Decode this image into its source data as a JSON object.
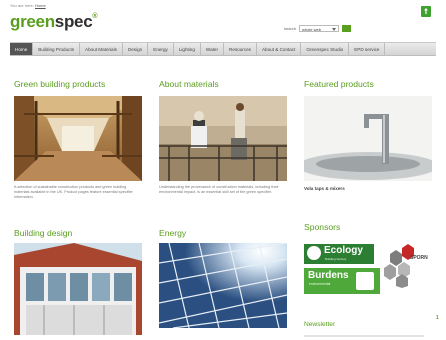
{
  "breadcrumb": {
    "prefix": "You are here:",
    "current": "Home"
  },
  "logo": {
    "green": "green",
    "dark": "spec",
    "mark": "®"
  },
  "search": {
    "label": "search",
    "scope": "whole web"
  },
  "nav": [
    "Home",
    "Building Products",
    "About Materials",
    "Design",
    "Energy",
    "Lighting",
    "Water",
    "Resources",
    "About & Contact",
    "Greenspec Studio",
    "EPD service"
  ],
  "sections": {
    "green_products": {
      "title": "Green building products",
      "caption": "A selection of sustainable construction products and green building materials available in the UK. Product pages feature essential specifier information."
    },
    "about_materials": {
      "title": "About materials",
      "caption": "Understanding the provenance of construction materials, including their environmental impact, is an essential skill set of the green specifier."
    },
    "featured": {
      "title": "Featured products",
      "caption": "Vola taps & mixers"
    },
    "building_design": {
      "title": "Building design"
    },
    "energy": {
      "title": "Energy"
    },
    "sponsors": {
      "title": "Sponsors",
      "ecology": "Ecology",
      "ecology_sub": "Building Society",
      "burdens": "Burdens",
      "burdens_sub": "environmental",
      "sporn": "SPORN"
    },
    "newsletter": {
      "title": "Newsletter"
    }
  },
  "page_marker": "1",
  "colors": {
    "brand_green": "#5a9e1f",
    "nav_active": "#555555"
  }
}
